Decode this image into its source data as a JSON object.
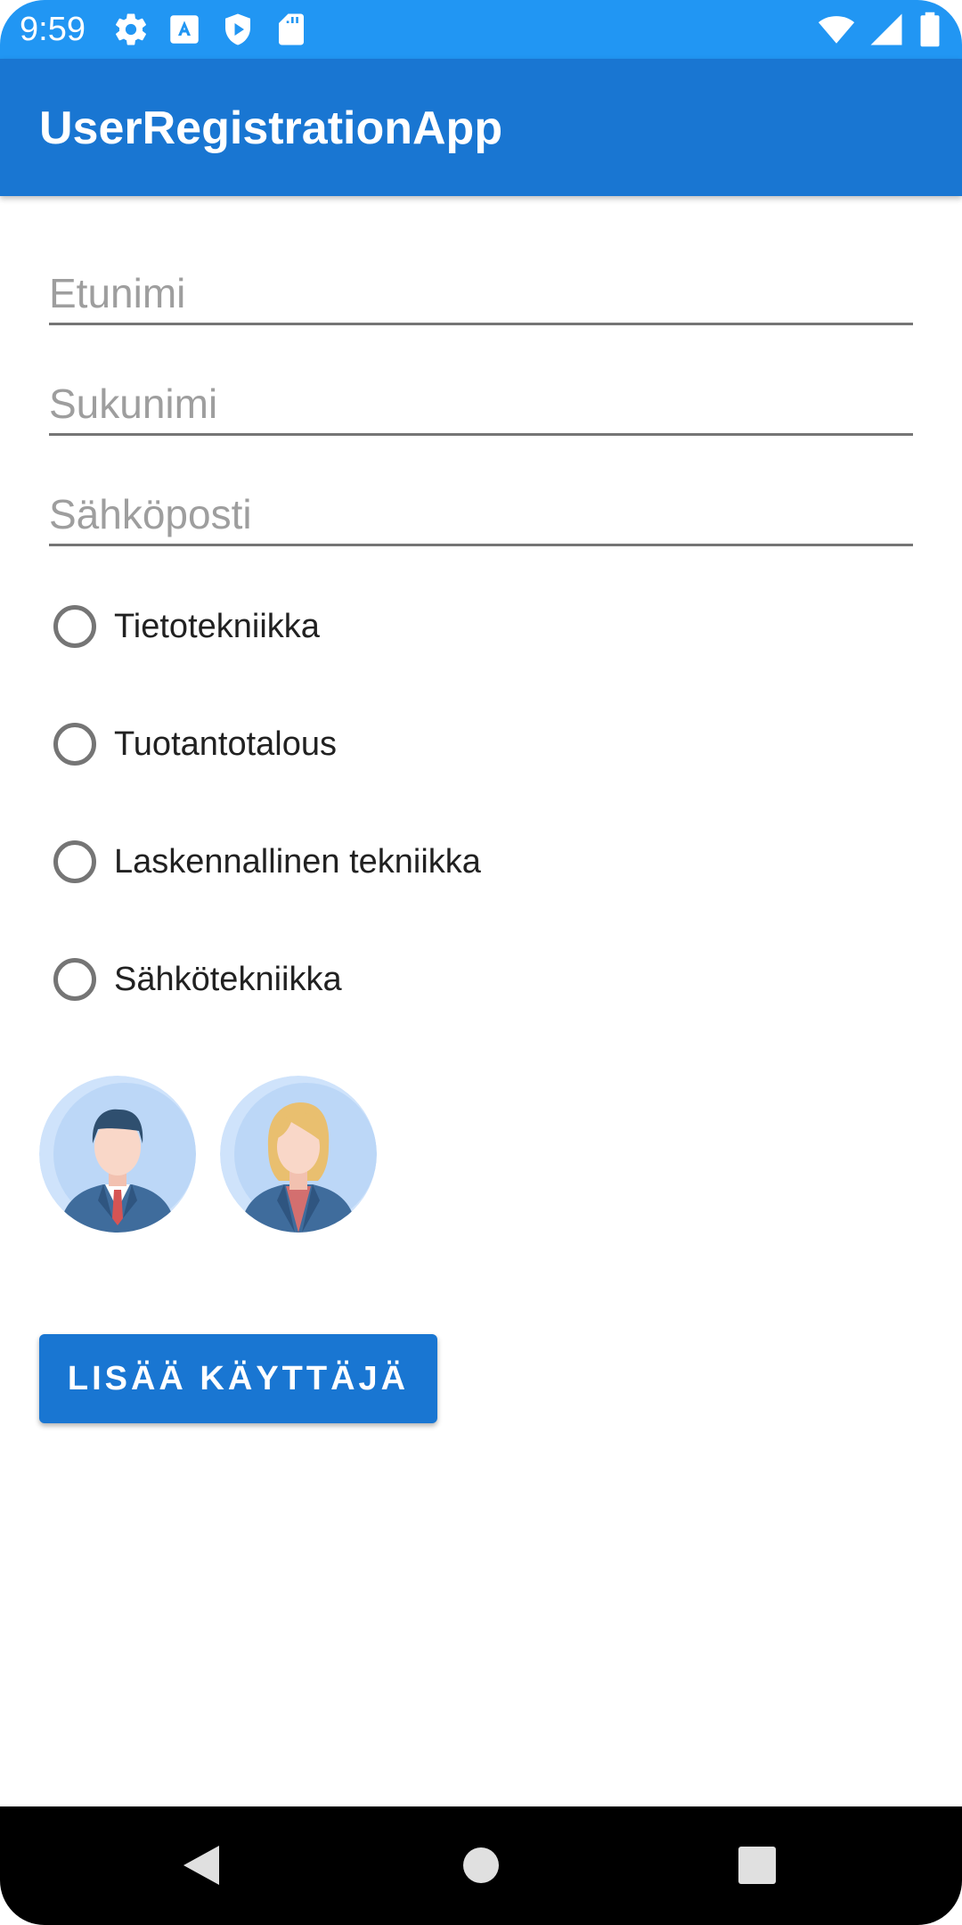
{
  "status_bar": {
    "time": "9:59",
    "left_icons": [
      "settings-gear-icon",
      "a-square-icon",
      "play-shield-icon",
      "sd-card-icon"
    ],
    "right_icons": [
      "wifi-icon",
      "cellular-signal-icon",
      "battery-icon"
    ],
    "background": "#2196F3"
  },
  "app_bar": {
    "title": "UserRegistrationApp",
    "background": "#1976D2"
  },
  "form": {
    "first_name": {
      "placeholder": "Etunimi",
      "value": ""
    },
    "last_name": {
      "placeholder": "Sukunimi",
      "value": ""
    },
    "email": {
      "placeholder": "Sähköposti",
      "value": ""
    }
  },
  "radio_options": [
    {
      "label": "Tietotekniikka",
      "selected": false
    },
    {
      "label": "Tuotantotalous",
      "selected": false
    },
    {
      "label": "Laskennallinen tekniikka",
      "selected": false
    },
    {
      "label": "Sähkötekniikka",
      "selected": false
    }
  ],
  "avatars": [
    "male-avatar-icon",
    "female-avatar-icon"
  ],
  "add_button": {
    "label": "LISÄÄ KÄYTTÄJÄ",
    "color": "#1976D2"
  },
  "nav_bar": {
    "buttons": [
      "back-triangle-icon",
      "home-circle-icon",
      "recents-square-icon"
    ]
  }
}
